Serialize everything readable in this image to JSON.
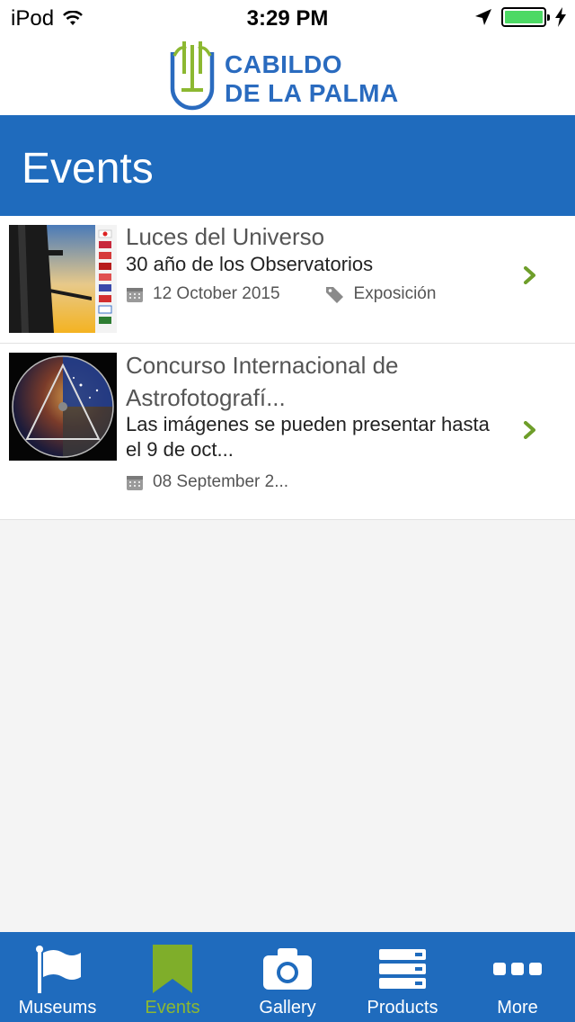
{
  "status_bar": {
    "device": "iPod",
    "time": "3:29 PM"
  },
  "brand": {
    "line1": "CABILDO",
    "line2": "DE LA PALMA",
    "color": "#2a6bbf",
    "accent": "#8cb831"
  },
  "page": {
    "title": "Events",
    "header_color": "#1f6bbd"
  },
  "events": [
    {
      "title": "Luces del Universo",
      "subtitle": "30 año de los Observatorios",
      "date": "12 October 2015",
      "category": "Exposición",
      "date_icon": "calendar-icon",
      "category_icon": "tag-icon"
    },
    {
      "title": "Concurso Internacional de Astrofotografí...",
      "subtitle": "Las imágenes se pueden presentar hasta el 9 de oct...",
      "date": "08 September 2...",
      "date_icon": "calendar-icon"
    }
  ],
  "tabs": [
    {
      "label": "Museums",
      "icon": "flag-icon",
      "active": false
    },
    {
      "label": "Events",
      "icon": "bookmark-icon",
      "active": true
    },
    {
      "label": "Gallery",
      "icon": "camera-icon",
      "active": false
    },
    {
      "label": "Products",
      "icon": "list-icon",
      "active": false
    },
    {
      "label": "More",
      "icon": "more-icon",
      "active": false
    }
  ]
}
